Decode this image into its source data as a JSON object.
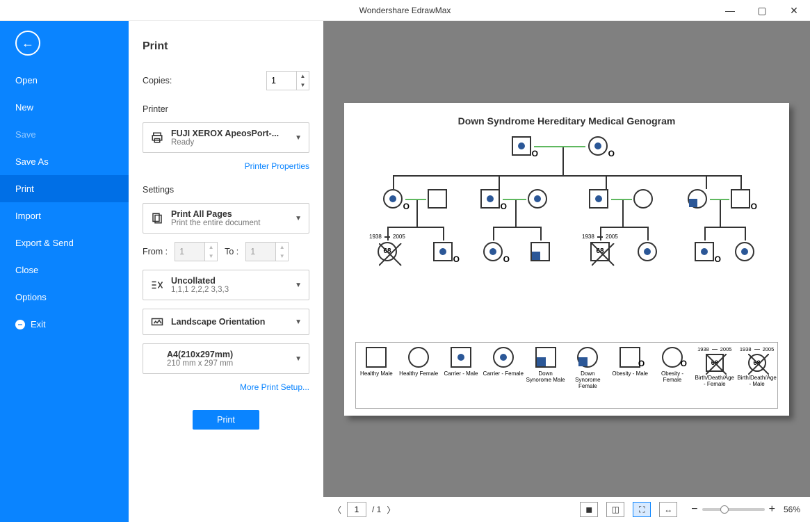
{
  "app_title": "Wondershare EdrawMax",
  "sidebar": {
    "items": [
      {
        "label": "Open"
      },
      {
        "label": "New"
      },
      {
        "label": "Save",
        "dim": true
      },
      {
        "label": "Save As"
      },
      {
        "label": "Print",
        "active": true
      },
      {
        "label": "Import"
      },
      {
        "label": "Export & Send"
      },
      {
        "label": "Close"
      },
      {
        "label": "Options"
      },
      {
        "label": "Exit",
        "exit": true
      }
    ]
  },
  "print": {
    "title": "Print",
    "copies_label": "Copies:",
    "copies_value": "1",
    "printer_section": "Printer",
    "printer_name": "FUJI XEROX ApeosPort-...",
    "printer_status": "Ready",
    "printer_props": "Printer Properties",
    "settings_section": "Settings",
    "print_pages_title": "Print All Pages",
    "print_pages_sub": "Print the entire document",
    "from_label": "From :",
    "from_value": "1",
    "to_label": "To :",
    "to_value": "1",
    "collate_title": "Uncollated",
    "collate_sub": "1,1,1   2,2,2   3,3,3",
    "orientation": "Landscape Orientation",
    "paper_title": "A4(210x297mm)",
    "paper_sub": "210 mm x 297 mm",
    "more_setup": "More Print Setup...",
    "print_button": "Print"
  },
  "preview": {
    "doc_title": "Down Syndrome Hereditary Medical Genogram",
    "legend": [
      {
        "label": "Healthy Male"
      },
      {
        "label": "Healthy Female"
      },
      {
        "label": "Carrier - Male"
      },
      {
        "label": "Carrier - Female"
      },
      {
        "label": "Down Synorome Male"
      },
      {
        "label": "Down Synorome Female"
      },
      {
        "label": "Obesity - Male"
      },
      {
        "label": "Obesity - Female"
      },
      {
        "label": "Birth/Death/Age - Female"
      },
      {
        "label": "Birth/Death/Age - Male"
      }
    ],
    "year1": "1938",
    "year2": "2005",
    "age": "68"
  },
  "footer": {
    "page_input": "1",
    "page_total": "/ 1",
    "zoom_label": "56%"
  }
}
